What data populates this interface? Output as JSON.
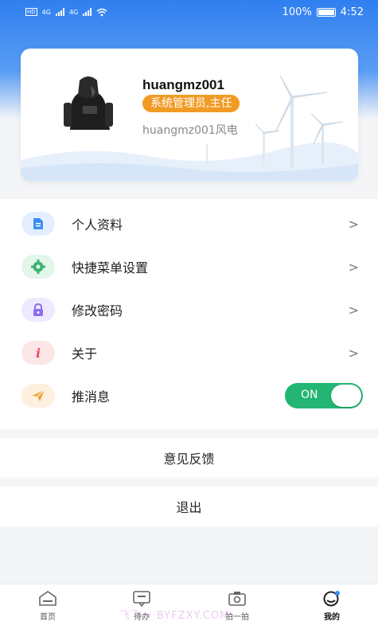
{
  "status_bar": {
    "network": "4G",
    "battery": "100%",
    "time": "4:52"
  },
  "profile": {
    "username": "huangmz001",
    "role": "系统管理员,主任",
    "organization": "huangmz001风电"
  },
  "menu": {
    "items": [
      {
        "label": "个人资料",
        "icon": "document-icon",
        "color": "#3b8ef3"
      },
      {
        "label": "快捷菜单设置",
        "icon": "gear-icon",
        "color": "#3cb371"
      },
      {
        "label": "修改密码",
        "icon": "lock-icon",
        "color": "#8e6cf0"
      },
      {
        "label": "关于",
        "icon": "info-icon",
        "color": "#ef4b57"
      },
      {
        "label": "推消息",
        "icon": "paper-plane-icon",
        "color": "#f0a33c"
      }
    ],
    "push_toggle": {
      "label": "ON",
      "on": true
    }
  },
  "feedback_label": "意见反馈",
  "logout_label": "退出",
  "tabs": [
    {
      "label": "首页",
      "icon": "home-icon",
      "active": false
    },
    {
      "label": "待办",
      "icon": "todo-icon",
      "active": false
    },
    {
      "label": "拍一拍",
      "icon": "camera-icon",
      "active": false
    },
    {
      "label": "我的",
      "icon": "profile-icon",
      "active": true
    }
  ],
  "watermark": "飞飞 • BYFZXY.COM",
  "colors": {
    "primary": "#2f7ff0",
    "toggle_on": "#23b573",
    "role_badge": "#f29b24"
  }
}
